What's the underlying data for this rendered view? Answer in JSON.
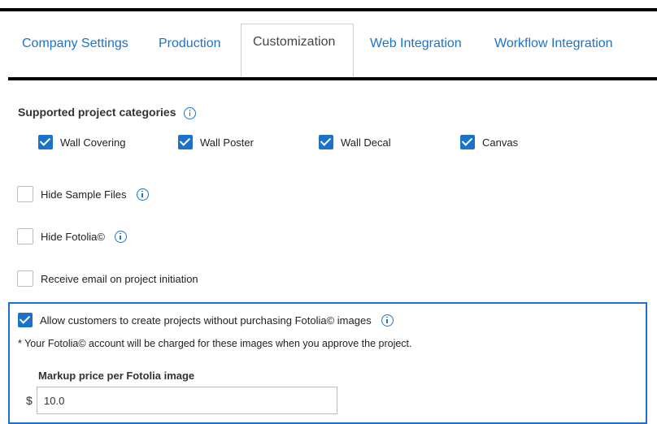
{
  "tabs": [
    {
      "label": "Company Settings",
      "active": false
    },
    {
      "label": "Production",
      "active": false
    },
    {
      "label": "Customization",
      "active": true
    },
    {
      "label": "Web Integration",
      "active": false
    },
    {
      "label": "Workflow Integration",
      "active": false
    }
  ],
  "categories": {
    "title": "Supported project categories",
    "items": [
      {
        "label": "Wall Covering",
        "checked": true
      },
      {
        "label": "Wall Poster",
        "checked": true
      },
      {
        "label": "Wall Decal",
        "checked": true
      },
      {
        "label": "Canvas",
        "checked": true
      }
    ]
  },
  "options": {
    "hide_sample_files": {
      "label": "Hide Sample Files",
      "checked": false
    },
    "hide_fotolia": {
      "label": "Hide Fotolia©",
      "checked": false
    },
    "receive_email": {
      "label": "Receive email on project initiation",
      "checked": false
    },
    "allow_without_purchase": {
      "label": "Allow customers to create projects without purchasing Fotolia© images",
      "checked": true
    }
  },
  "fotolia_panel": {
    "note": "* Your Fotolia© account will be charged for these images when you approve the project.",
    "markup_label": "Markup price per Fotolia image",
    "currency_symbol": "$",
    "markup_value": "10.0"
  },
  "colors": {
    "accent": "#1a73c9"
  }
}
